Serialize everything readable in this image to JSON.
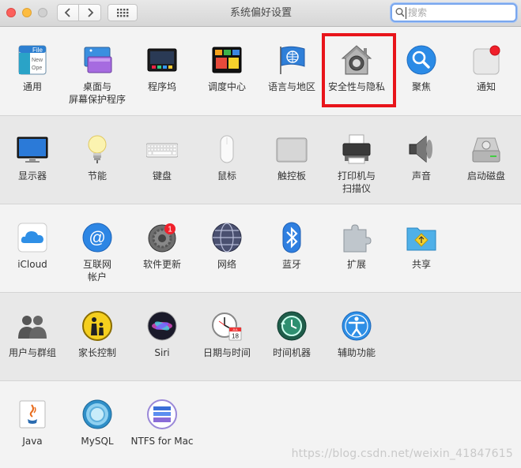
{
  "window": {
    "title": "系统偏好设置"
  },
  "search": {
    "placeholder": "搜索"
  },
  "rows": [
    [
      {
        "label": "通用",
        "icon": "general-icon"
      },
      {
        "label": "桌面与\n屏幕保护程序",
        "icon": "desktop-screensaver-icon"
      },
      {
        "label": "程序坞",
        "icon": "dock-icon"
      },
      {
        "label": "调度中心",
        "icon": "mission-control-icon"
      },
      {
        "label": "语言与地区",
        "icon": "language-region-icon"
      },
      {
        "label": "安全性与隐私",
        "icon": "security-privacy-icon"
      },
      {
        "label": "聚焦",
        "icon": "spotlight-icon"
      },
      {
        "label": "通知",
        "icon": "notifications-icon"
      }
    ],
    [
      {
        "label": "显示器",
        "icon": "displays-icon"
      },
      {
        "label": "节能",
        "icon": "energy-saver-icon"
      },
      {
        "label": "键盘",
        "icon": "keyboard-icon"
      },
      {
        "label": "鼠标",
        "icon": "mouse-icon"
      },
      {
        "label": "触控板",
        "icon": "trackpad-icon"
      },
      {
        "label": "打印机与\n扫描仪",
        "icon": "printers-scanners-icon"
      },
      {
        "label": "声音",
        "icon": "sound-icon"
      },
      {
        "label": "启动磁盘",
        "icon": "startup-disk-icon"
      }
    ],
    [
      {
        "label": "iCloud",
        "icon": "icloud-icon"
      },
      {
        "label": "互联网\n帐户",
        "icon": "internet-accounts-icon"
      },
      {
        "label": "软件更新",
        "icon": "software-update-icon",
        "badge": "1"
      },
      {
        "label": "网络",
        "icon": "network-icon"
      },
      {
        "label": "蓝牙",
        "icon": "bluetooth-icon"
      },
      {
        "label": "扩展",
        "icon": "extensions-icon"
      },
      {
        "label": "共享",
        "icon": "sharing-icon"
      }
    ],
    [
      {
        "label": "用户与群组",
        "icon": "users-groups-icon"
      },
      {
        "label": "家长控制",
        "icon": "parental-controls-icon"
      },
      {
        "label": "Siri",
        "icon": "siri-icon"
      },
      {
        "label": "日期与时间",
        "icon": "date-time-icon",
        "cal_month": "JUL",
        "cal_day": "18"
      },
      {
        "label": "时间机器",
        "icon": "time-machine-icon"
      },
      {
        "label": "辅助功能",
        "icon": "accessibility-icon"
      }
    ],
    [
      {
        "label": "Java",
        "icon": "java-icon"
      },
      {
        "label": "MySQL",
        "icon": "mysql-icon"
      },
      {
        "label": "NTFS for Mac",
        "icon": "ntfs-for-mac-icon"
      }
    ]
  ],
  "general_icon_text": [
    "File",
    "New",
    "Ope"
  ],
  "watermark": "https://blog.csdn.net/weixin_41847615",
  "colors": {
    "highlight": "#e8141a",
    "search_focus": "#7aa7ee"
  }
}
